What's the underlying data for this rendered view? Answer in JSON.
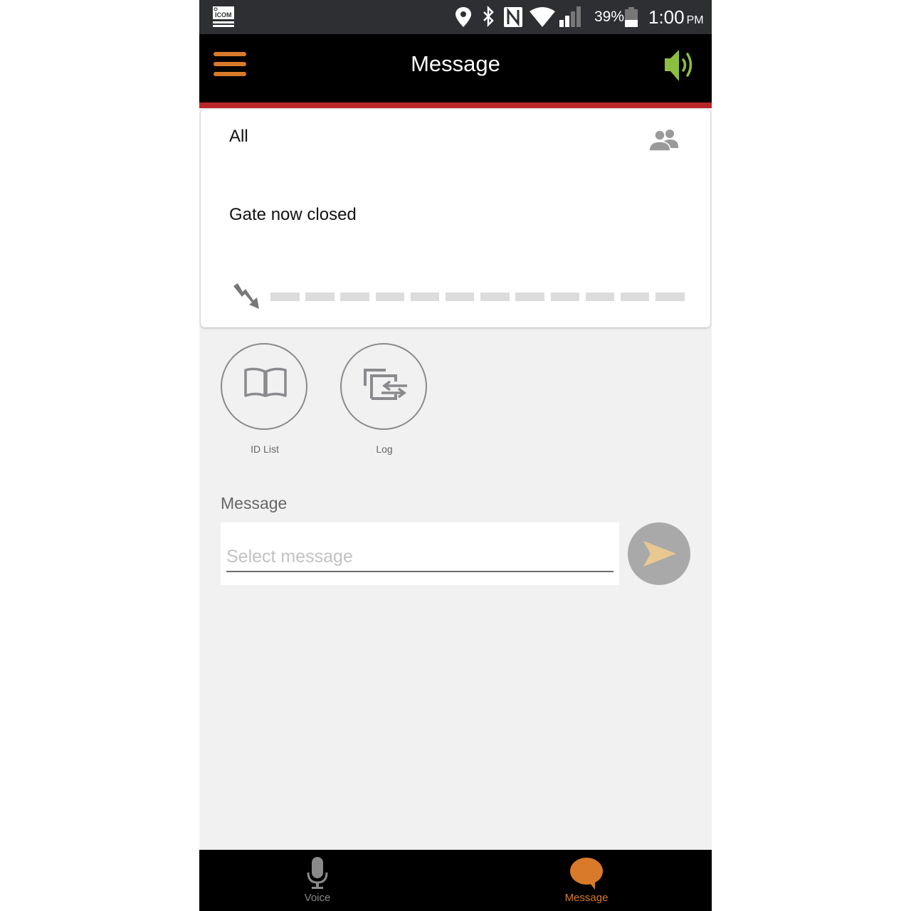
{
  "status_bar": {
    "app_logo": "ICOM",
    "icons": [
      "location-icon",
      "bluetooth-icon",
      "nfc-icon",
      "wifi-icon",
      "cell-signal-icon"
    ],
    "cell_signal_bars": 2,
    "cell_signal_max": 4,
    "battery_percent": "39%",
    "battery_level": 0.39,
    "time": "1:00",
    "ampm": "PM"
  },
  "app_bar": {
    "title": "Message",
    "menu_icon": "hamburger-menu-icon",
    "speaker_icon": "speaker-on-icon"
  },
  "colors": {
    "accent_orange": "#d97a2a",
    "speaker_green": "#8cbf3f",
    "header_red": "#b9262a",
    "signal_inactive": "#dcdcdc"
  },
  "received_card": {
    "destination": "All",
    "destination_icon": "group-icon",
    "message": "Gate now closed",
    "signal_icon": "lightning-arrow-icon",
    "signal_level": 0,
    "signal_segments": 12
  },
  "actions": [
    {
      "label": "ID List",
      "icon": "book-icon"
    },
    {
      "label": "Log",
      "icon": "log-transfer-icon"
    }
  ],
  "compose": {
    "label": "Message",
    "placeholder": "Select message",
    "value": "",
    "send_icon": "send-icon"
  },
  "bottom_nav": [
    {
      "label": "Voice",
      "icon": "microphone-icon",
      "active": false
    },
    {
      "label": "Message",
      "icon": "chat-bubble-icon",
      "active": true
    }
  ]
}
